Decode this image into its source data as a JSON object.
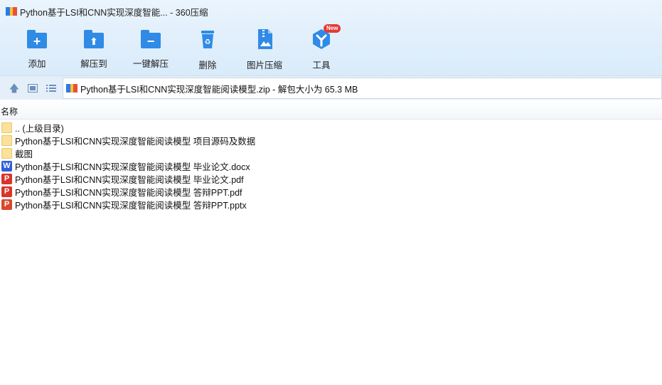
{
  "window": {
    "title": "Python基于LSI和CNN实现深度智能...  - 360压缩"
  },
  "toolbar": {
    "items": [
      {
        "label": "添加",
        "icon": "add-folder-icon"
      },
      {
        "label": "解压到",
        "icon": "extract-to-icon"
      },
      {
        "label": "一键解压",
        "icon": "one-click-extract-icon"
      },
      {
        "label": "删除",
        "icon": "recycle-bin-icon"
      },
      {
        "label": "图片压缩",
        "icon": "image-compress-icon"
      },
      {
        "label": "工具",
        "icon": "tools-icon",
        "badge": "New"
      }
    ]
  },
  "addressbar": {
    "path": "Python基于LSI和CNN实现深度智能阅读模型.zip - 解包大小为 65.3 MB"
  },
  "list": {
    "column_name": "名称",
    "items": [
      {
        "name": ".. (上级目录)",
        "type": "folder"
      },
      {
        "name": "Python基于LSI和CNN实现深度智能阅读模型 项目源码及数据",
        "type": "folder"
      },
      {
        "name": "截图",
        "type": "folder"
      },
      {
        "name": "Python基于LSI和CNN实现深度智能阅读模型 毕业论文.docx",
        "type": "word"
      },
      {
        "name": "Python基于LSI和CNN实现深度智能阅读模型 毕业论文.pdf",
        "type": "pdf"
      },
      {
        "name": "Python基于LSI和CNN实现深度智能阅读模型 答辩PPT.pdf",
        "type": "pdf"
      },
      {
        "name": "Python基于LSI和CNN实现深度智能阅读模型 答辩PPT.pptx",
        "type": "ppt"
      }
    ]
  },
  "colors": {
    "accent": "#2f8be6",
    "toolbar_bg": "#e2effb",
    "folder": "#fbe19a",
    "word": "#2f5fd6",
    "pdf": "#d9342b",
    "badge": "#e53935"
  }
}
